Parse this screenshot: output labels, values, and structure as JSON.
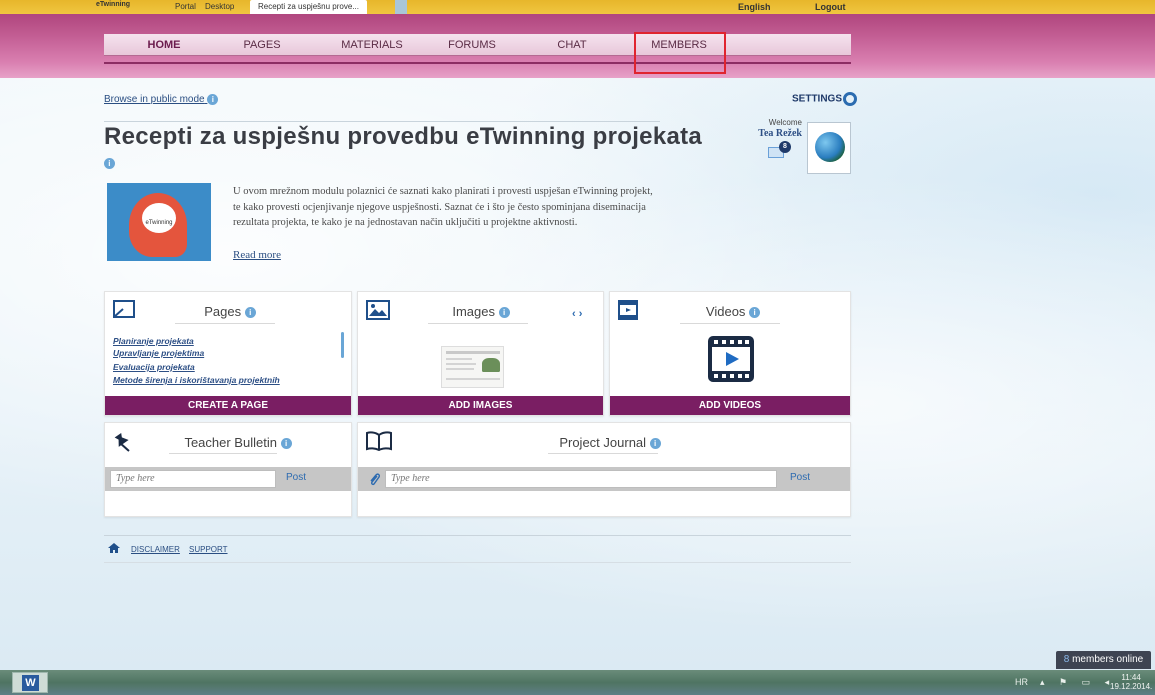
{
  "browser": {
    "tab_logo": "eTwinning",
    "tabs": [
      "Portal",
      "Desktop",
      "Recepti za uspješnu prove..."
    ],
    "language": "English",
    "logout": "Logout"
  },
  "nav": {
    "items": [
      "HOME",
      "PAGES",
      "MATERIALS",
      "FORUMS",
      "CHAT",
      "MEMBERS"
    ]
  },
  "page": {
    "browse_public": "Browse in public mode",
    "settings": "SETTINGS",
    "title": "Recepti za uspješnu provedbu eTwinning projekata",
    "welcome": "Welcome",
    "user_name": "Tea Režek",
    "mail_count": "8",
    "intro_image_label": "eTwinning",
    "intro": "U ovom mrežnom modulu polaznici će saznati kako planirati i provesti uspješan eTwinning projekt, te kako provesti ocjenjivanje njegove uspješnosti. Saznat će i što je često spominjana diseminacija rezultata projekta, te kako je na jednostavan način uključiti u projektne aktivnosti.",
    "read_more": "Read more"
  },
  "widgets": {
    "pages": {
      "title": "Pages",
      "links": [
        "Planiranje projekata",
        "Upravljanje projektima",
        "Evaluacija projekata",
        "Metode širenja i iskorištavanja projektnih"
      ],
      "button": "CREATE A PAGE"
    },
    "images": {
      "title": "Images",
      "nav": "‹ ›",
      "button": "ADD IMAGES"
    },
    "videos": {
      "title": "Videos",
      "button": "ADD VIDEOS"
    },
    "bulletin": {
      "title": "Teacher Bulletin",
      "placeholder": "Type here",
      "post": "Post"
    },
    "journal": {
      "title": "Project Journal",
      "placeholder": "Type here",
      "post": "Post"
    }
  },
  "footer": {
    "disclaimer": "DISCLAIMER",
    "support": "SUPPORT"
  },
  "members_online": {
    "count": "8",
    "label": "members online"
  },
  "taskbar": {
    "lang": "HR",
    "time": "11:44",
    "date": "19.12.2014."
  },
  "colors": {
    "header": "#c35e94",
    "button": "#7a1e63",
    "highlight": "#e0242f",
    "link": "#2a4e82"
  }
}
